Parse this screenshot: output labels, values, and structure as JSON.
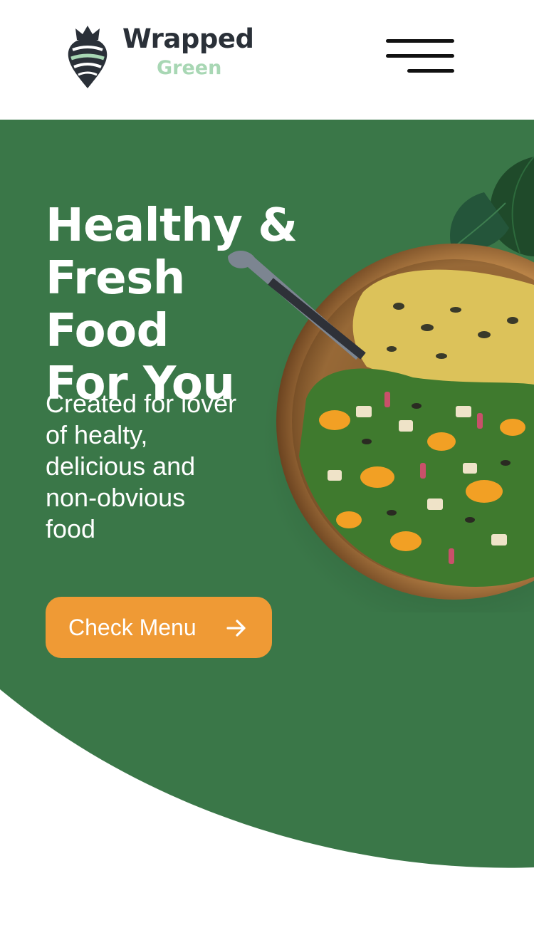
{
  "brand": {
    "word1": "Wrapped",
    "word2": "Green",
    "logo_icon": "beet-bee-icon"
  },
  "header": {
    "menu_icon": "hamburger-menu-icon"
  },
  "hero": {
    "title_lines": [
      "Healthy &",
      "Fresh Food",
      "For You"
    ],
    "subtitle_lines": [
      "Created for lover",
      "of healty,",
      "delicious and",
      "non-obvious",
      "food"
    ],
    "cta_label": "Check Menu",
    "cta_icon": "arrow-right-icon",
    "image": "salad-bowl-image"
  },
  "colors": {
    "hero_green": "#3a7748",
    "cta_orange": "#ef9a35",
    "logo_dark": "#2a3038",
    "logo_green": "#a8d7b4"
  }
}
